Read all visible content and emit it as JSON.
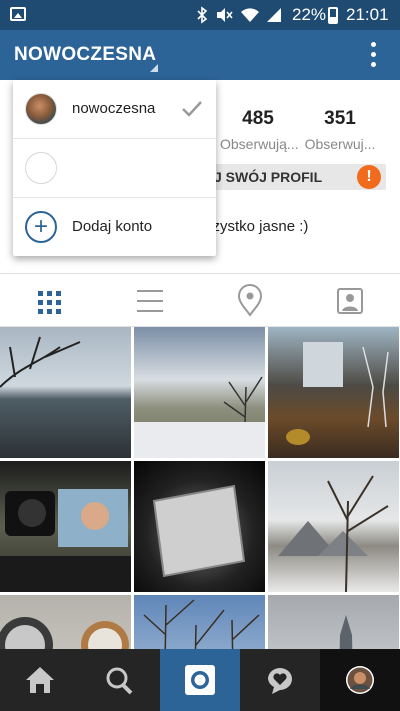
{
  "status_bar": {
    "battery": "22%",
    "time": "21:01",
    "icons": [
      "gallery-icon",
      "bluetooth-icon",
      "mute-icon",
      "wifi-icon",
      "signal-icon",
      "battery-icon"
    ]
  },
  "header": {
    "username": "NOWOCZESNA",
    "menu_icon": "more-vertical-icon"
  },
  "profile": {
    "stats": [
      {
        "value": "485",
        "label": "Obserwują..."
      },
      {
        "value": "351",
        "label": "Obserwuj..."
      }
    ],
    "edit_button": "J SWÓJ PROFIL",
    "warning": "!",
    "bio": "szystko jasne :)"
  },
  "account_menu": {
    "items": [
      {
        "label": "nowoczesna",
        "selected": true
      },
      {
        "label": "",
        "selected": false
      },
      {
        "label": "Dodaj konto",
        "icon": "plus-icon"
      }
    ]
  },
  "view_tabs": [
    "grid-icon",
    "list-icon",
    "location-icon",
    "tagged-icon"
  ],
  "bottom_nav": [
    "home-icon",
    "search-icon",
    "camera-icon",
    "activity-icon",
    "profile-icon"
  ],
  "colors": {
    "status_bar": "#1f4a72",
    "header": "#2c6497",
    "accent": "#2c6497",
    "warning": "#f26b1d",
    "bottom_nav": "#252525"
  }
}
